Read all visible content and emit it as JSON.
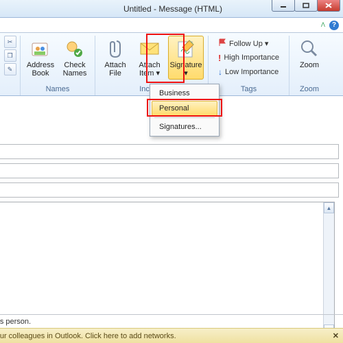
{
  "window": {
    "title": "Untitled - Message (HTML)"
  },
  "ribbon": {
    "groups": {
      "names": {
        "label": "Names",
        "address_book": "Address\nBook",
        "check_names": "Check\nNames"
      },
      "include": {
        "label": "Include",
        "attach_file": "Attach\nFile",
        "attach_item": "Attach\nItem ▾",
        "signature": "Signature\n▾"
      },
      "tags": {
        "label": "Tags",
        "follow_up": "Follow Up ▾",
        "high": "High Importance",
        "low": "Low Importance"
      },
      "zoom": {
        "label": "Zoom",
        "zoom": "Zoom"
      }
    }
  },
  "signature_menu": {
    "items": [
      "Business",
      "Personal",
      "Signatures..."
    ],
    "selected": "Personal"
  },
  "footer": {
    "line1": "m this person.",
    "line2": " of your colleagues in Outlook. Click here to add networks."
  }
}
